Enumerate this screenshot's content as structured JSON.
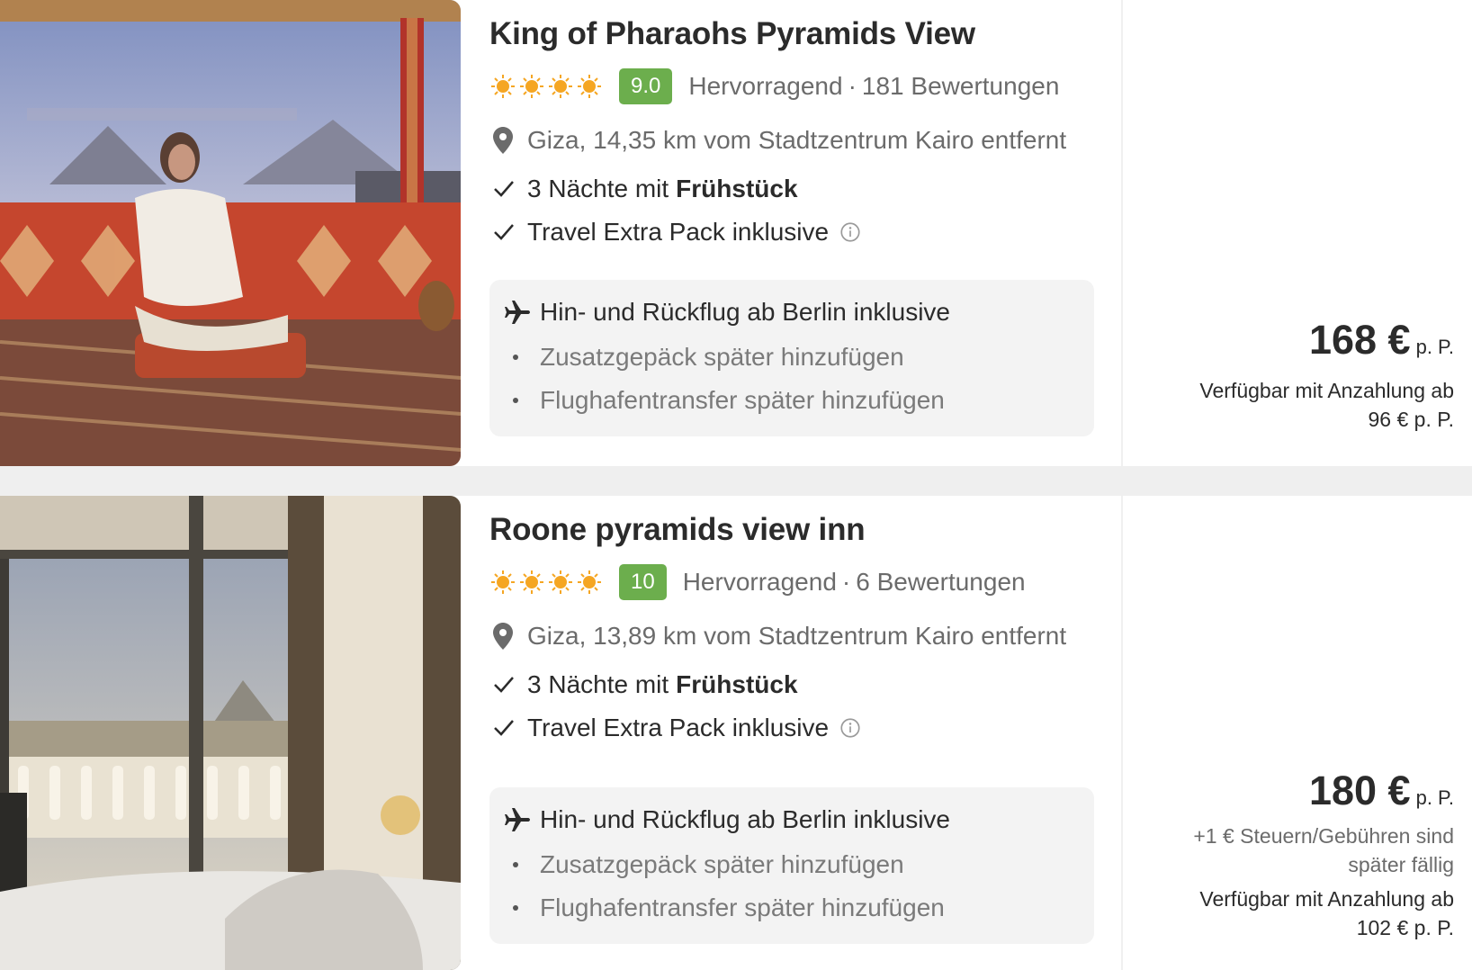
{
  "offers": [
    {
      "title": "King of Pharaohs Pyramids View",
      "stars": 4,
      "score": "9.0",
      "rating_label": "Hervorragend",
      "separator": "·",
      "reviews": "181 Bewertungen",
      "location": "Giza, 14,35 km vom Stadtzentrum Kairo entfernt",
      "nights_prefix": "3 Nächte mit",
      "board": "Frühstück",
      "extra_pack": "Travel Extra Pack inklusive",
      "flight": "Hin- und Rückflug ab Berlin inklusive",
      "addon_luggage": "Zusatzgepäck später hinzufügen",
      "addon_transfer": "Flughafentransfer später hinzufügen",
      "price": "168 €",
      "price_unit": "p. P.",
      "fees_note": "",
      "deposit_line1": "Verfügbar mit Anzahlung ab",
      "deposit_line2": "96 € p. P.",
      "image_alt": "woman-on-rooftop-pyramids"
    },
    {
      "title": "Roone pyramids view inn",
      "stars": 4,
      "score": "10",
      "rating_label": "Hervorragend",
      "separator": "·",
      "reviews": "6 Bewertungen",
      "location": "Giza, 13,89 km vom Stadtzentrum Kairo entfernt",
      "nights_prefix": "3 Nächte mit",
      "board": "Frühstück",
      "extra_pack": "Travel Extra Pack inklusive",
      "flight": "Hin- und Rückflug ab Berlin inklusive",
      "addon_luggage": "Zusatzgepäck später hinzufügen",
      "addon_transfer": "Flughafentransfer später hinzufügen",
      "price": "180 €",
      "price_unit": "p. P.",
      "fees_line1": "+1 € Steuern/Gebühren sind",
      "fees_line2": "später fällig",
      "deposit_line1": "Verfügbar mit Anzahlung ab",
      "deposit_line2": "102 € p. P.",
      "image_alt": "hotel-room-pyramid-view"
    }
  ],
  "colors": {
    "score_bg": "#6cae4d",
    "sun": "#f5a623",
    "text_dark": "#2b2b2b",
    "text_gray": "#6b6b6b",
    "box_bg": "#f3f3f3"
  }
}
